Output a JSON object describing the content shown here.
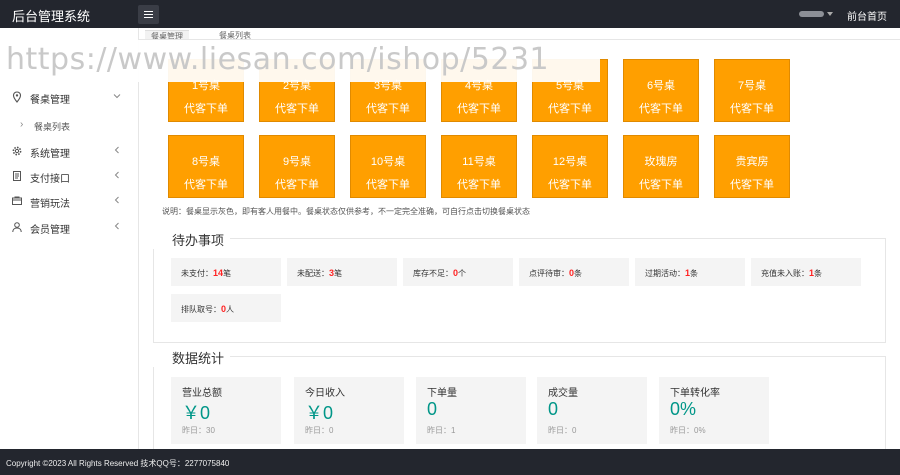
{
  "header": {
    "app_title": "后台管理系统",
    "home_link": "前台首页"
  },
  "tabs": [
    {
      "label": "餐桌管理"
    },
    {
      "label": "餐桌列表"
    }
  ],
  "watermark": "https://www.liesan.com/ishop/5231",
  "sidebar": {
    "items": [
      {
        "label": "餐桌管理",
        "icon": "location-icon"
      },
      {
        "label": "系统管理",
        "icon": "gear-icon"
      },
      {
        "label": "支付接口",
        "icon": "document-icon"
      },
      {
        "label": "营销玩法",
        "icon": "card-icon"
      },
      {
        "label": "会员管理",
        "icon": "user-icon"
      }
    ],
    "sub_item": {
      "label": "餐桌列表"
    }
  },
  "tables": [
    {
      "name": "1号桌",
      "action": "代客下单"
    },
    {
      "name": "2号桌",
      "action": "代客下单"
    },
    {
      "name": "3号桌",
      "action": "代客下单"
    },
    {
      "name": "4号桌",
      "action": "代客下单"
    },
    {
      "name": "5号桌",
      "action": "代客下单"
    },
    {
      "name": "6号桌",
      "action": "代客下单"
    },
    {
      "name": "7号桌",
      "action": "代客下单"
    },
    {
      "name": "8号桌",
      "action": "代客下单"
    },
    {
      "name": "9号桌",
      "action": "代客下单"
    },
    {
      "name": "10号桌",
      "action": "代客下单"
    },
    {
      "name": "11号桌",
      "action": "代客下单"
    },
    {
      "name": "12号桌",
      "action": "代客下单"
    },
    {
      "name": "玫瑰房",
      "action": "代客下单"
    },
    {
      "name": "贵宾房",
      "action": "代客下单"
    }
  ],
  "tables_note": "说明：餐桌显示灰色，即有客人用餐中。餐桌状态仅供参考，不一定完全准确，可自行点击切换餐桌状态",
  "todo": {
    "title": "待办事项",
    "items": [
      {
        "label": "未支付：",
        "value": "14",
        "unit": "笔"
      },
      {
        "label": "未配送：",
        "value": "3",
        "unit": "笔"
      },
      {
        "label": "库存不足：",
        "value": "0",
        "unit": "个"
      },
      {
        "label": "点评待审：",
        "value": "0",
        "unit": "条"
      },
      {
        "label": "过期活动：",
        "value": "1",
        "unit": "条"
      },
      {
        "label": "充值未入账：",
        "value": "1",
        "unit": "条"
      },
      {
        "label": "排队取号：",
        "value": "0",
        "unit": "人"
      }
    ]
  },
  "stats": {
    "title": "数据统计",
    "cards": [
      {
        "label": "营业总额",
        "value": "￥0",
        "yesterday": "昨日：30"
      },
      {
        "label": "今日收入",
        "value": "￥0",
        "yesterday": "昨日：0"
      },
      {
        "label": "下单量",
        "value": "0",
        "yesterday": "昨日：1"
      },
      {
        "label": "成交量",
        "value": "0",
        "yesterday": "昨日：0"
      },
      {
        "label": "下单转化率",
        "value": "0%",
        "yesterday": "昨日：0%"
      }
    ]
  },
  "footer": {
    "text": "Copyright ©2023    All Rights Reserved    技术QQ号：2277075840"
  },
  "colors": {
    "topbar": "#23262e",
    "table_card": "#ff9f00",
    "stat_value": "#009688",
    "todo_value": "#ff2222"
  }
}
